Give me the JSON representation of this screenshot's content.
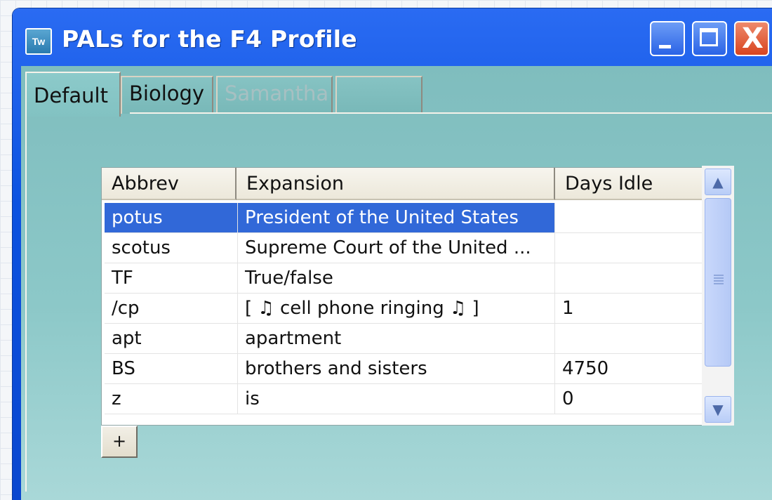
{
  "window": {
    "title": "PALs for the F4 Profile",
    "app_icon_text": "Tw",
    "close_glyph": "X"
  },
  "tabs": [
    {
      "label": "Default",
      "state": "active"
    },
    {
      "label": "Biology",
      "state": "normal"
    },
    {
      "label": "Samantha",
      "state": "disabled"
    },
    {
      "label": "",
      "state": "normal"
    }
  ],
  "table": {
    "columns": [
      "Abbrev",
      "Expansion",
      "Days Idle"
    ],
    "rows": [
      {
        "abbrev": "potus",
        "expansion": "President of the United States",
        "days_idle": "",
        "selected": true
      },
      {
        "abbrev": "scotus",
        "expansion": "Supreme Court of the United ...",
        "days_idle": ""
      },
      {
        "abbrev": "TF",
        "expansion": "True/false",
        "days_idle": ""
      },
      {
        "abbrev": "/cp",
        "expansion": "[ ♫ cell phone ringing ♫ ]",
        "days_idle": "1"
      },
      {
        "abbrev": "apt",
        "expansion": "apartment",
        "days_idle": ""
      },
      {
        "abbrev": "BS",
        "expansion": "brothers and sisters",
        "days_idle": "4750"
      },
      {
        "abbrev": "z",
        "expansion": "is",
        "days_idle": "0"
      }
    ]
  },
  "add_button_label": "+",
  "colors": {
    "titlebar": "#0c52e0",
    "client": "#82c2c2",
    "selection": "#3168d8"
  }
}
